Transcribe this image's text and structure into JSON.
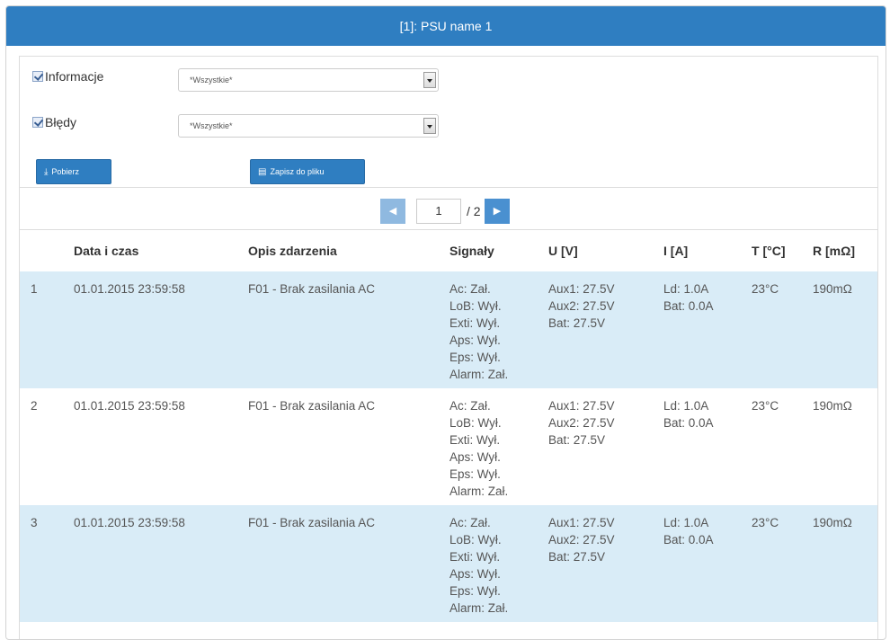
{
  "header": {
    "title": "[1]: PSU name 1"
  },
  "filters": [
    {
      "label": "Informacje",
      "checked": true,
      "select_value": "*Wszystkie*"
    },
    {
      "label": "Błędy",
      "checked": true,
      "select_value": "*Wszystkie*"
    }
  ],
  "buttons": {
    "download_label": "Pobierz",
    "download_icon": "download-icon",
    "save_label": "Zapisz do pliku",
    "save_icon": "save-file-icon"
  },
  "pager": {
    "current": "1",
    "total": "/ 2",
    "prev_icon": "chevron-left-icon",
    "next_icon": "chevron-right-icon"
  },
  "table": {
    "columns": [
      "",
      "Data i czas",
      "Opis zdarzenia",
      "Signały",
      "U [V]",
      "I [A]",
      "T [°C]",
      "R [mΩ]"
    ],
    "rows": [
      {
        "num": "1",
        "datetime": "01.01.2015 23:59:58",
        "desc": "F01 - Brak zasilania AC",
        "signals": [
          "Ac: Zał.",
          "LoB: Wył.",
          "Exti: Wył.",
          "Aps: Wył.",
          "Eps: Wył.",
          "Alarm: Zał."
        ],
        "voltage": [
          "Aux1: 27.5V",
          "Aux2: 27.5V",
          "Bat: 27.5V"
        ],
        "current": [
          "Ld: 1.0A",
          "Bat: 0.0A"
        ],
        "temp": "23°C",
        "res": "190mΩ"
      },
      {
        "num": "2",
        "datetime": "01.01.2015 23:59:58",
        "desc": "F01 - Brak zasilania AC",
        "signals": [
          "Ac: Zał.",
          "LoB: Wył.",
          "Exti: Wył.",
          "Aps: Wył.",
          "Eps: Wył.",
          "Alarm: Zał."
        ],
        "voltage": [
          "Aux1: 27.5V",
          "Aux2: 27.5V",
          "Bat: 27.5V"
        ],
        "current": [
          "Ld: 1.0A",
          "Bat: 0.0A"
        ],
        "temp": "23°C",
        "res": "190mΩ"
      },
      {
        "num": "3",
        "datetime": "01.01.2015 23:59:58",
        "desc": "F01 - Brak zasilania AC",
        "signals": [
          "Ac: Zał.",
          "LoB: Wył.",
          "Exti: Wył.",
          "Aps: Wył.",
          "Eps: Wył.",
          "Alarm: Zał."
        ],
        "voltage": [
          "Aux1: 27.5V",
          "Aux2: 27.5V",
          "Bat: 27.5V"
        ],
        "current": [
          "Ld: 1.0A",
          "Bat: 0.0A"
        ],
        "temp": "23°C",
        "res": "190mΩ"
      }
    ]
  }
}
